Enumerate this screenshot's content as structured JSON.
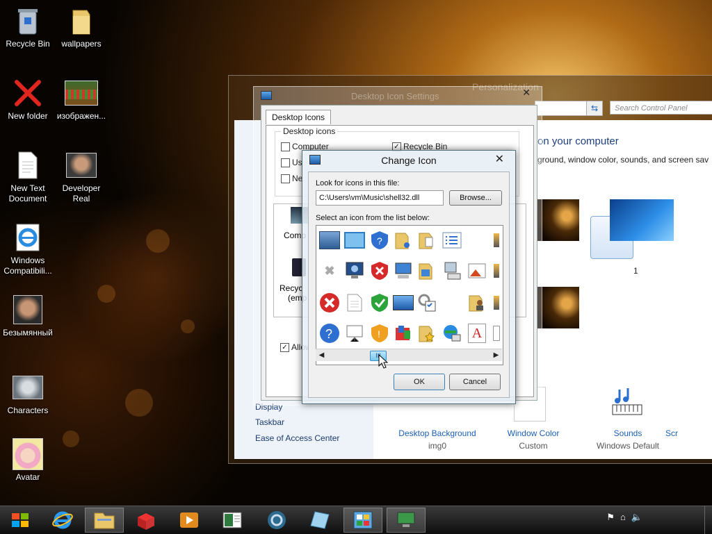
{
  "desktop": {
    "icons": [
      {
        "label": "Recycle Bin",
        "icon": "recycle-bin-icon"
      },
      {
        "label": "wallpapers",
        "icon": "folder-icon"
      },
      {
        "label": "New folder",
        "icon": "red-x-icon"
      },
      {
        "label": "изображен...",
        "icon": "image-thumbnail-icon"
      },
      {
        "label": "New Text Document",
        "icon": "text-document-icon"
      },
      {
        "label": "Developer Real",
        "icon": "photo-icon"
      },
      {
        "label": "Windows Compatibili...",
        "icon": "ie-icon"
      },
      {
        "label": "Безымянный",
        "icon": "photo-icon"
      },
      {
        "label": "Characters",
        "icon": "characters-icon"
      },
      {
        "label": "Avatar",
        "icon": "avatar-icon"
      }
    ]
  },
  "personalization": {
    "title": "Personalization",
    "search_placeholder": "Search Control Panel",
    "heading": "on your computer",
    "subheading": "ground, window color, sounds, and screen sav",
    "left_links": [
      "Display",
      "Taskbar",
      "Ease of Access Center"
    ],
    "theme_number": "1",
    "bottom_items": [
      {
        "label": "Desktop Background",
        "value": "img0"
      },
      {
        "label": "Window Color",
        "value": "Custom"
      },
      {
        "label": "Sounds",
        "value": "Windows Default"
      },
      {
        "label": "Scr",
        "value": ""
      }
    ]
  },
  "desktop_icon_settings": {
    "title": "Desktop Icon Settings",
    "tab": "Desktop Icons",
    "group_title": "Desktop icons",
    "checkboxes": [
      {
        "label": "Computer",
        "checked": false
      },
      {
        "label": "Recycle Bin",
        "checked": true
      },
      {
        "label": "Us",
        "checked": false
      },
      {
        "label": "Ne",
        "checked": false
      }
    ],
    "preview_labels": [
      "Comp",
      "Recyc",
      "(emp"
    ],
    "allow_label": "Allow"
  },
  "change_icon": {
    "title": "Change Icon",
    "look_label": "Look for icons in this file:",
    "path_value": "C:\\Users\\vm\\Music\\shell32.dll",
    "browse_label": "Browse...",
    "select_label": "Select an icon from the list below:",
    "ok_label": "OK",
    "cancel_label": "Cancel",
    "scroll_thumb": "III"
  },
  "colors": {
    "accent_blue": "#1b5fb4",
    "heading_blue": "#1e3f7d"
  }
}
